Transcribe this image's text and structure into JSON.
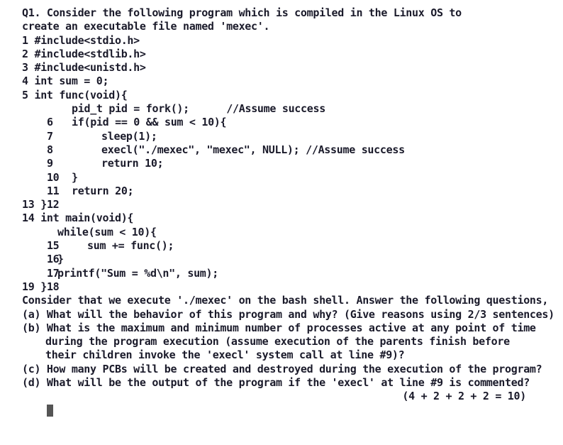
{
  "question": {
    "title_line1": "Q1. Consider the following program which is compiled in the Linux OS to",
    "title_line2": "create an executable file named 'mexec'."
  },
  "code": {
    "l1": "1 #include<stdio.h>",
    "l2": "2 #include<stdlib.h>",
    "l3": "3 #include<unistd.h>",
    "l4": "4 int sum = 0;",
    "l5": "5 int func(void){",
    "l6_num": "6",
    "l6_code": "pid_t pid = fork();      //Assume success",
    "l7_num": "7",
    "l7_code": "if(pid == 0 && sum < 10){",
    "l8_num": "8",
    "l8_code": "sleep(1);",
    "l9_num": "9",
    "l9_code": "execl(\"./mexec\", \"mexec\", NULL); //Assume success",
    "l10_num": "10",
    "l10_code": "return 10;",
    "l11_num": "11",
    "l11_code": "}",
    "l12_num": "12",
    "l12_code": "return 20;",
    "l13": "13 }",
    "l14": "14 int main(void){",
    "l15_num": "15",
    "l15_code": "while(sum < 10){",
    "l16_num": "16",
    "l16_code": "sum += func();",
    "l17_num": "17",
    "l17_code": "}",
    "l18_num": "18",
    "l18_code": "printf(\"Sum = %d\\n\", sum);",
    "l19": "19 }"
  },
  "prompt": {
    "intro": "Consider that we execute './mexec' on the bash shell. Answer the following questions,",
    "a": "(a) What will the behavior of this program and why? (Give reasons using 2/3 sentences)",
    "b1": "(b) What is the maximum and minimum number of processes active at any point of time",
    "b2": "during the program execution (assume execution of the parents finish before",
    "b3": "their children invoke the 'execl' system call at line #9)?",
    "c": "(c) How many PCBs will be created and destroyed during the execution of the program?",
    "d": "(d) What will be the output of the program if the 'execl' at line #9 is commented?",
    "marks": "(4 + 2 + 2 + 2 = 10)"
  }
}
